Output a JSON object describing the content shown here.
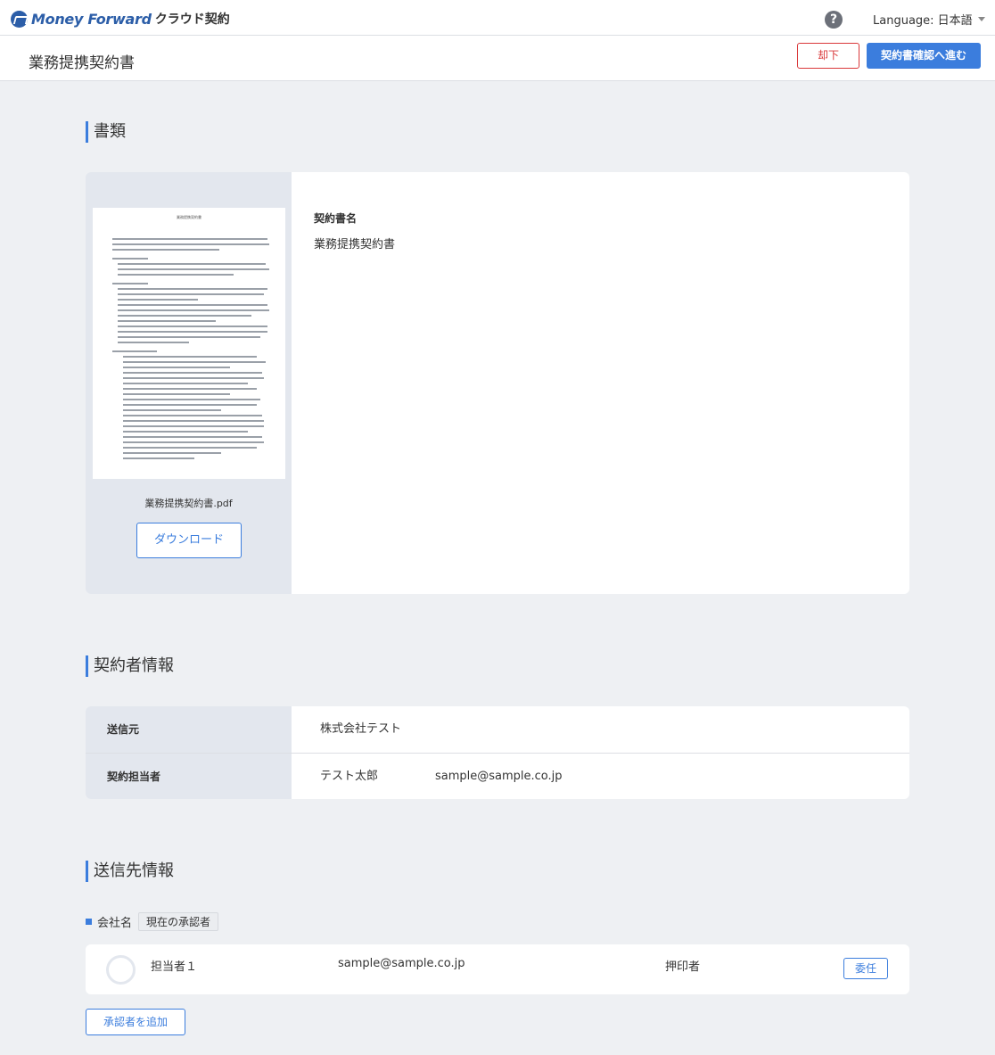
{
  "header": {
    "logo_text": "Money Forward",
    "product_name": "クラウド契約",
    "help_icon": "question-circle-icon",
    "help_glyph": "?",
    "language_label": "Language: 日本語"
  },
  "subheader": {
    "page_title": "業務提携契約書",
    "reject_label": "却下",
    "proceed_label": "契約書確認へ進む"
  },
  "documents": {
    "section_title": "書類",
    "thumbnail_title": "業務提携契約書",
    "filename": "業務提携契約書.pdf",
    "download_label": "ダウンロード",
    "contract_name_label": "契約書名",
    "contract_name_value": "業務提携契約書"
  },
  "contractor": {
    "section_title": "契約者情報",
    "rows": [
      {
        "label": "送信元",
        "value": "株式会社テスト",
        "email": ""
      },
      {
        "label": "契約担当者",
        "value": "テスト太郎",
        "email": "sample@sample.co.jp"
      }
    ]
  },
  "recipients": {
    "section_title": "送信先情報",
    "company_label": "会社名",
    "current_badge": "現在の承認者",
    "approvers": [
      {
        "name": "担当者１",
        "email": "sample@sample.co.jp",
        "role": "押印者",
        "delegate_label": "委任"
      }
    ],
    "add_approver_label": "承認者を追加"
  },
  "colors": {
    "accent": "#3b7ddd",
    "danger": "#d9383a",
    "brand": "#2c5ea8",
    "background": "#eef0f3"
  }
}
